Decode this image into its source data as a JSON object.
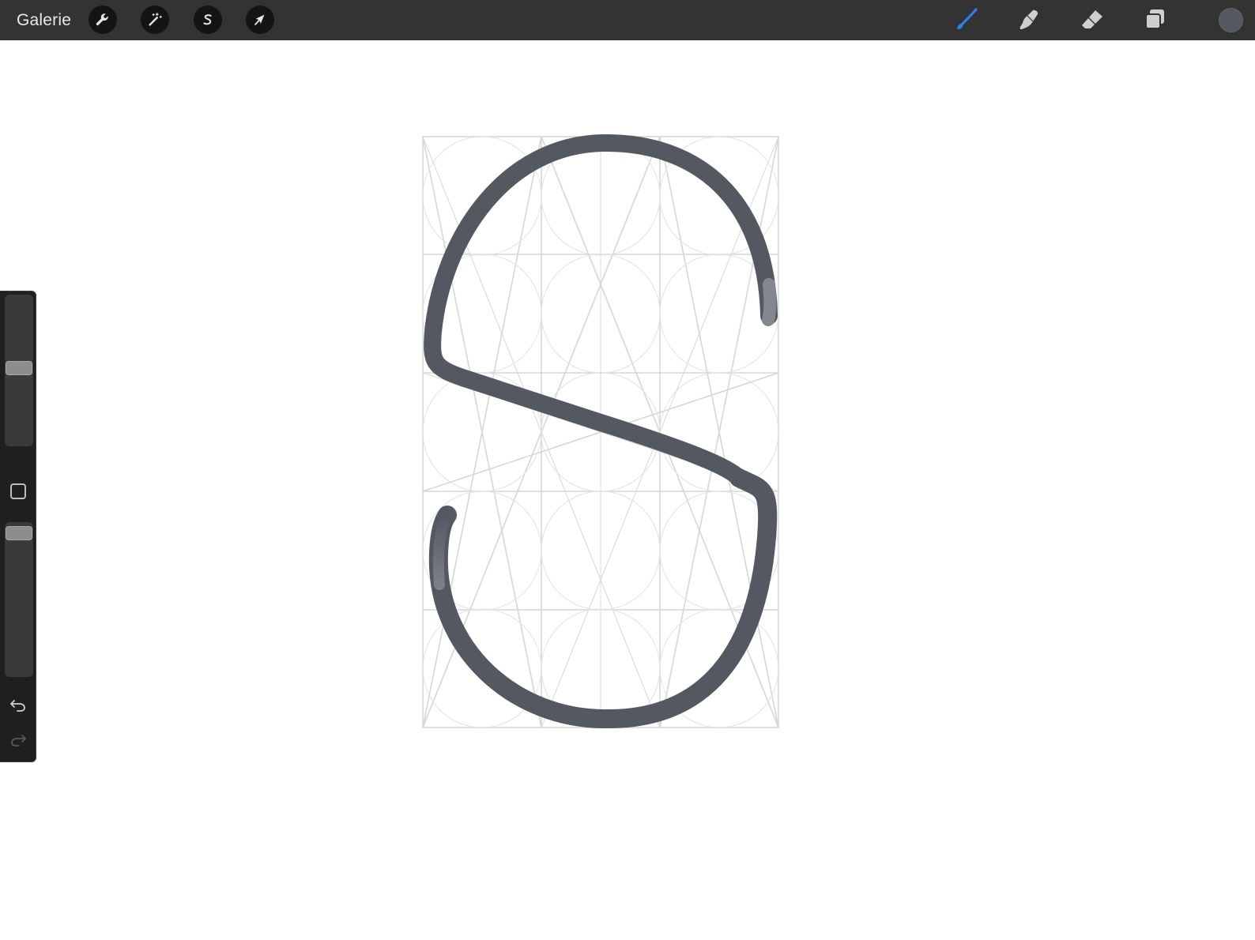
{
  "topbar": {
    "gallery_label": "Galerie",
    "left_tools": [
      {
        "name": "actions",
        "icon": "wrench-icon"
      },
      {
        "name": "adjustments",
        "icon": "magic-wand-icon"
      },
      {
        "name": "selection",
        "icon": "selection-s-icon"
      },
      {
        "name": "transform",
        "icon": "arrow-cursor-icon"
      }
    ],
    "right_tools": [
      {
        "name": "brush",
        "icon": "brush-icon",
        "active": true
      },
      {
        "name": "smudge",
        "icon": "smudge-finger-icon",
        "active": false
      },
      {
        "name": "eraser",
        "icon": "eraser-icon",
        "active": false
      },
      {
        "name": "layers",
        "icon": "layers-icon",
        "active": false
      }
    ],
    "current_color": "#535861"
  },
  "colors": {
    "toolbar_bg": "#333333",
    "active_tool": "#2f7fea",
    "stroke": "#535861",
    "guide": "#d6d6d6"
  },
  "sidebar": {
    "brush_size_fraction": 0.48,
    "opacity_fraction": 0.03
  }
}
